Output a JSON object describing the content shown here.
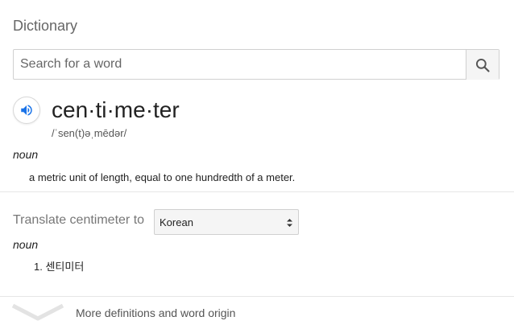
{
  "header": {
    "title": "Dictionary"
  },
  "search": {
    "placeholder": "Search for a word",
    "value": "",
    "icon": "search-icon"
  },
  "entry": {
    "word": "cen·ti·me·ter",
    "phonetic": "/ˈsen(t)əˌmēdər/",
    "part_of_speech": "noun",
    "definition": "a metric unit of length, equal to one hundredth of a meter."
  },
  "translate": {
    "label": "Translate centimeter to",
    "language": "Korean",
    "part_of_speech": "noun",
    "items": [
      {
        "number": "1.",
        "text": "센티미터"
      }
    ]
  },
  "footer": {
    "more_label": "More definitions and word origin"
  },
  "colors": {
    "accent": "#1a73e8",
    "divider": "#e6e6e6",
    "muted": "#666666"
  }
}
